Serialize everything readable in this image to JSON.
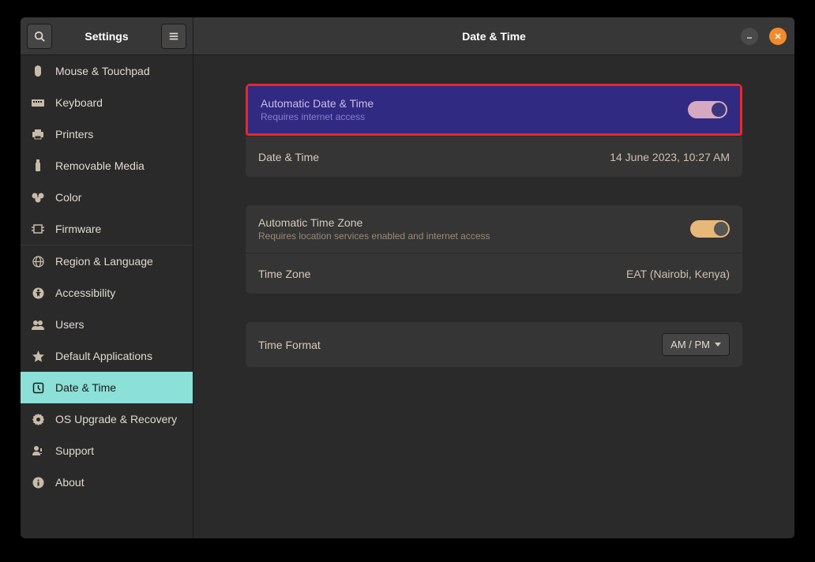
{
  "sidebar": {
    "title": "Settings",
    "items": [
      {
        "label": "Mouse & Touchpad",
        "icon": "mouse"
      },
      {
        "label": "Keyboard",
        "icon": "keyboard"
      },
      {
        "label": "Printers",
        "icon": "printer"
      },
      {
        "label": "Removable Media",
        "icon": "usb"
      },
      {
        "label": "Color",
        "icon": "color"
      },
      {
        "label": "Firmware",
        "icon": "chip"
      },
      {
        "label": "Region & Language",
        "icon": "globe",
        "separator": true
      },
      {
        "label": "Accessibility",
        "icon": "a11y"
      },
      {
        "label": "Users",
        "icon": "users"
      },
      {
        "label": "Default Applications",
        "icon": "star"
      },
      {
        "label": "Date & Time",
        "icon": "clock",
        "active": true
      },
      {
        "label": "OS Upgrade & Recovery",
        "icon": "gear"
      },
      {
        "label": "Support",
        "icon": "support"
      },
      {
        "label": "About",
        "icon": "info"
      }
    ]
  },
  "main": {
    "title": "Date & Time",
    "groups": [
      {
        "rows": [
          {
            "title": "Automatic Date & Time",
            "subtitle": "Requires internet access",
            "toggle_on": true,
            "highlighted": true
          },
          {
            "title": "Date & Time",
            "value": "14 June 2023, 10:27 AM"
          }
        ]
      },
      {
        "rows": [
          {
            "title": "Automatic Time Zone",
            "subtitle": "Requires location services enabled and internet access",
            "toggle_on": true
          },
          {
            "title": "Time Zone",
            "value": "EAT (Nairobi, Kenya)"
          }
        ]
      },
      {
        "rows": [
          {
            "title": "Time Format",
            "select": "AM / PM"
          }
        ]
      }
    ]
  }
}
